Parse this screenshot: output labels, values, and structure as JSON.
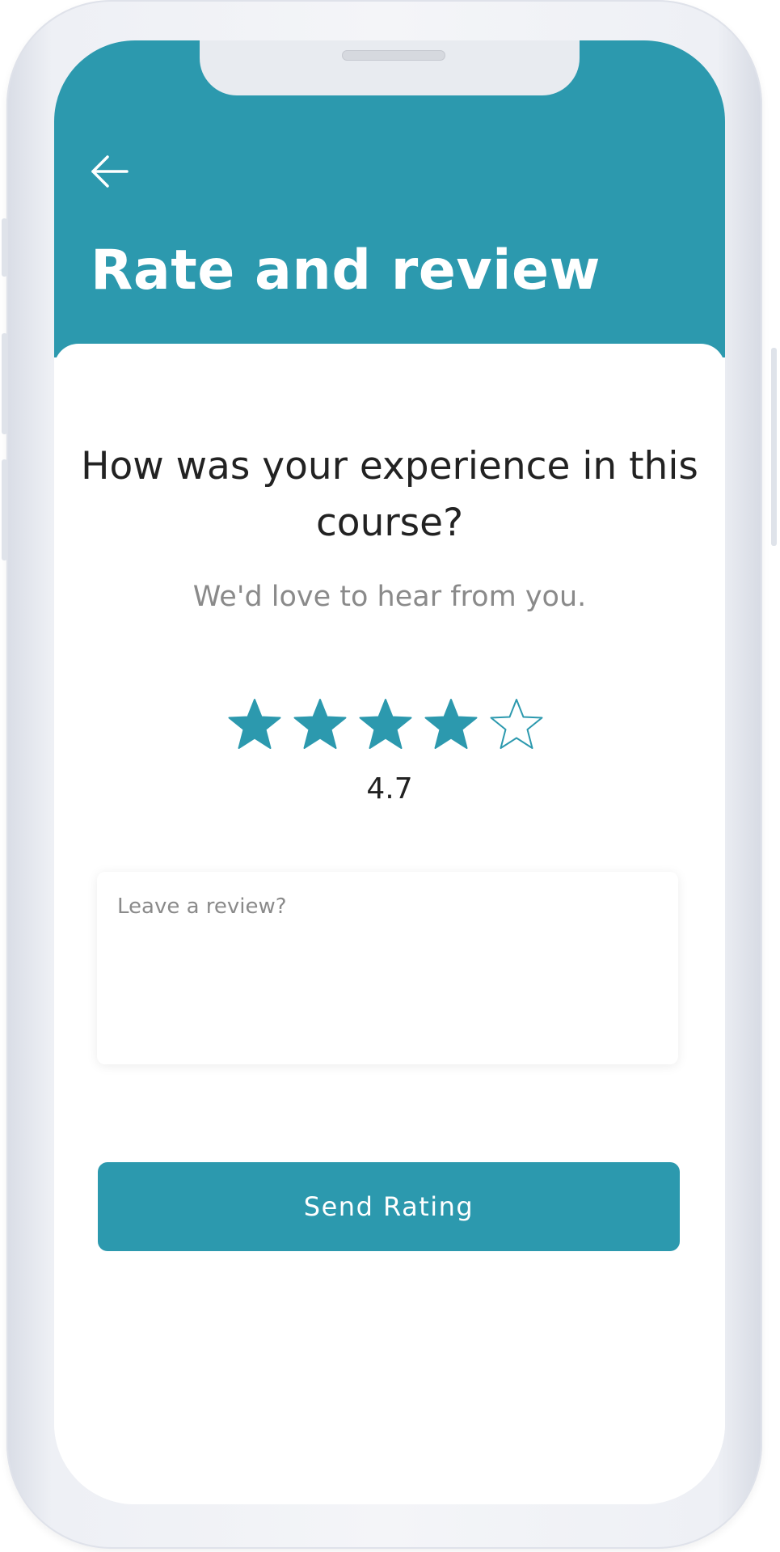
{
  "header": {
    "back_icon": "arrow-left-icon",
    "title": "Rate and review"
  },
  "main": {
    "question": "How was your experience in this course?",
    "subtitle": "We'd love to hear from you.",
    "rating": {
      "stars_total": 5,
      "stars_filled": 4,
      "value": "4.7"
    },
    "review": {
      "placeholder": "Leave a review?",
      "value": ""
    },
    "send_button_label": "Send Rating"
  },
  "colors": {
    "accent": "#2c99ae",
    "title_text": "#ffffff",
    "body_text": "#222222",
    "muted_text": "#8a8a8a"
  }
}
